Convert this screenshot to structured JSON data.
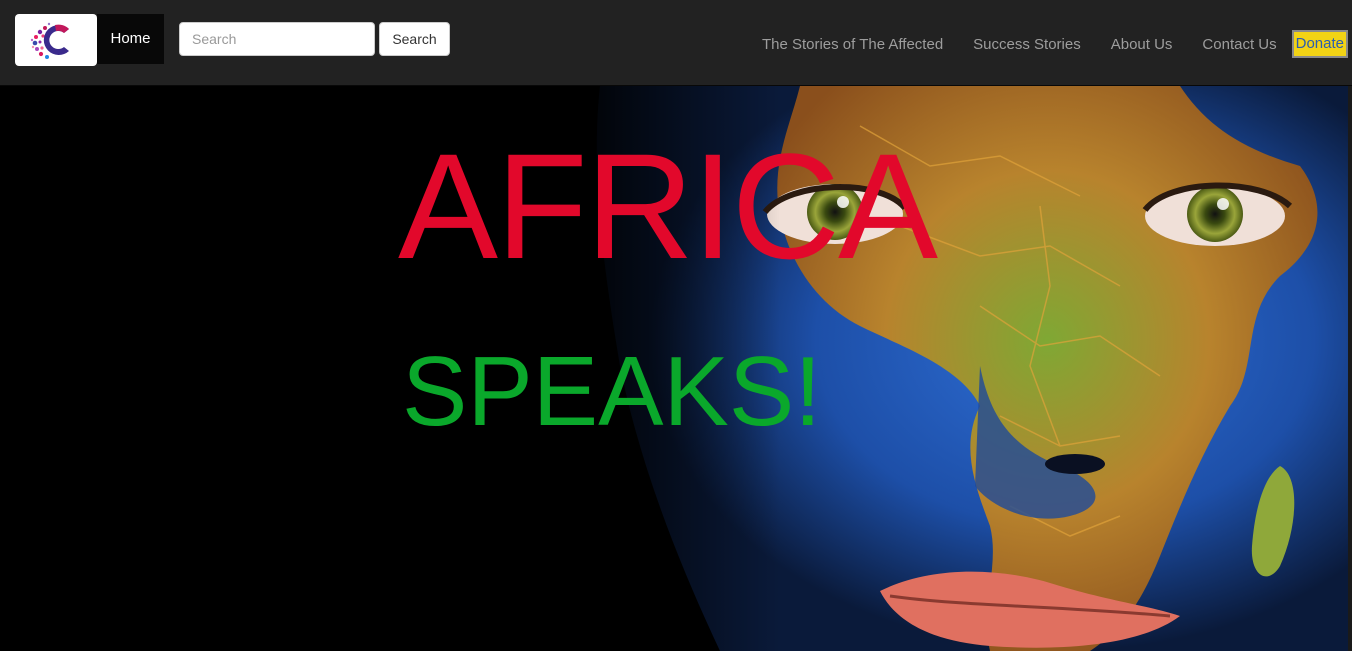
{
  "navbar": {
    "logo_icon": "letter-c-logo-icon",
    "home_label": "Home",
    "search_placeholder": "Search",
    "search_value": "",
    "search_button_label": "Search",
    "links": [
      {
        "label": "The Stories of The Affected"
      },
      {
        "label": "Success Stories"
      },
      {
        "label": "About Us"
      },
      {
        "label": "Contact Us"
      }
    ],
    "donate_label": "Donate"
  },
  "hero": {
    "title_line1": "AFRICA",
    "title_line2": "SPEAKS!",
    "background_image": "face painted with map of Africa",
    "colors": {
      "title_line1": "#e2082b",
      "title_line2": "#0aa82b",
      "donate_background": "#f2d315",
      "navbar_background": "#222222"
    }
  }
}
